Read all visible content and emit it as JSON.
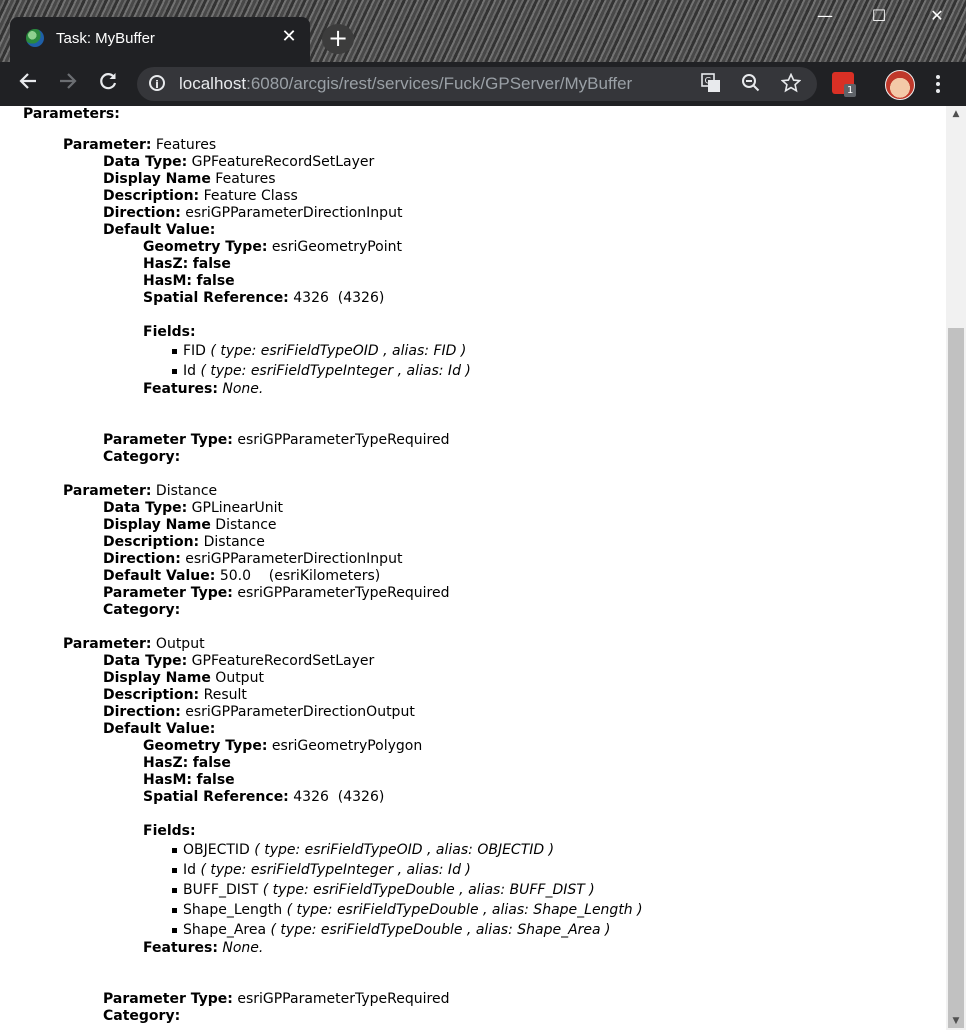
{
  "browser": {
    "tab_title": "Task: MyBuffer",
    "tab_close": "✕",
    "new_tab": "+",
    "url_host": "localhost",
    "url_rest": ":6080/arcgis/rest/services/Fuck/GPServer/MyBuffer",
    "extension_badge": "1",
    "window_controls": {
      "minimize": "—",
      "maximize": "☐",
      "close": "✕"
    }
  },
  "page": {
    "parameters_heading": "Parameters:",
    "labels": {
      "parameter": "Parameter:",
      "data_type": "Data Type:",
      "display_name": "Display Name",
      "description": "Description:",
      "direction": "Direction:",
      "default_value": "Default Value:",
      "geometry_type": "Geometry Type:",
      "hasz": "HasZ:",
      "hasm": "HasM:",
      "spatial_reference": "Spatial Reference:",
      "fields": "Fields:",
      "features": "Features:",
      "parameter_type": "Parameter Type:",
      "category": "Category:"
    },
    "params": [
      {
        "name": "Features",
        "data_type": "GPFeatureRecordSetLayer",
        "display_name": "Features",
        "description": "Feature Class",
        "direction": "esriGPParameterDirectionInput",
        "geometry_type": "esriGeometryPoint",
        "hasz": "false",
        "hasm": "false",
        "spatial_reference": "4326  (4326)",
        "fields": [
          {
            "name": "FID",
            "detail": "( type: esriFieldTypeOID , alias: FID )"
          },
          {
            "name": "Id",
            "detail": "( type: esriFieldTypeInteger , alias: Id )"
          }
        ],
        "features": "None.",
        "parameter_type": "esriGPParameterTypeRequired"
      },
      {
        "name": "Distance",
        "data_type": "GPLinearUnit",
        "display_name": "Distance",
        "description": "Distance",
        "direction": "esriGPParameterDirectionInput",
        "default_value": "50.0    (esriKilometers)",
        "parameter_type": "esriGPParameterTypeRequired"
      },
      {
        "name": "Output",
        "data_type": "GPFeatureRecordSetLayer",
        "display_name": "Output",
        "description": "Result",
        "direction": "esriGPParameterDirectionOutput",
        "geometry_type": "esriGeometryPolygon",
        "hasz": "false",
        "hasm": "false",
        "spatial_reference": "4326  (4326)",
        "fields": [
          {
            "name": "OBJECTID",
            "detail": "( type: esriFieldTypeOID , alias: OBJECTID )"
          },
          {
            "name": "Id",
            "detail": "( type: esriFieldTypeInteger , alias: Id )"
          },
          {
            "name": "BUFF_DIST",
            "detail": "( type: esriFieldTypeDouble , alias: BUFF_DIST )"
          },
          {
            "name": "Shape_Length",
            "detail": "( type: esriFieldTypeDouble , alias: Shape_Length )"
          },
          {
            "name": "Shape_Area",
            "detail": "( type: esriFieldTypeDouble , alias: Shape_Area )"
          }
        ],
        "features": "None.",
        "parameter_type": "esriGPParameterTypeRequired"
      }
    ]
  }
}
